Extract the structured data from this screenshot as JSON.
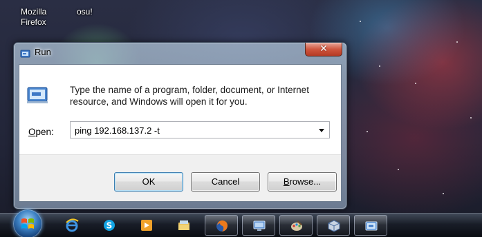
{
  "desktop": {
    "icons": [
      {
        "label": "Mozilla Firefox"
      },
      {
        "label": "osu!"
      }
    ]
  },
  "run_dialog": {
    "title": "Run",
    "prompt": "Type the name of a program, folder, document, or Internet resource, and Windows will open it for you.",
    "open_label_accel": "O",
    "open_label_rest": "pen:",
    "open_value": "ping 192.168.137.2 -t",
    "buttons": {
      "ok": "OK",
      "cancel": "Cancel",
      "browse_accel": "B",
      "browse_rest": "rowse..."
    }
  },
  "taskbar": {
    "items": [
      {
        "icon": "internet-explorer-icon",
        "active": false
      },
      {
        "icon": "skype-icon",
        "active": false
      },
      {
        "icon": "media-player-icon",
        "active": false
      },
      {
        "icon": "windows-explorer-icon",
        "active": false
      },
      {
        "icon": "firefox-icon",
        "active": true
      },
      {
        "icon": "remote-desktop-icon",
        "active": true
      },
      {
        "icon": "paint-icon",
        "active": true
      },
      {
        "icon": "virtualbox-icon",
        "active": true
      },
      {
        "icon": "run-icon",
        "active": true
      }
    ]
  },
  "colors": {
    "close_button": "#d0563e",
    "ok_button_border": "#3c7fb1"
  }
}
